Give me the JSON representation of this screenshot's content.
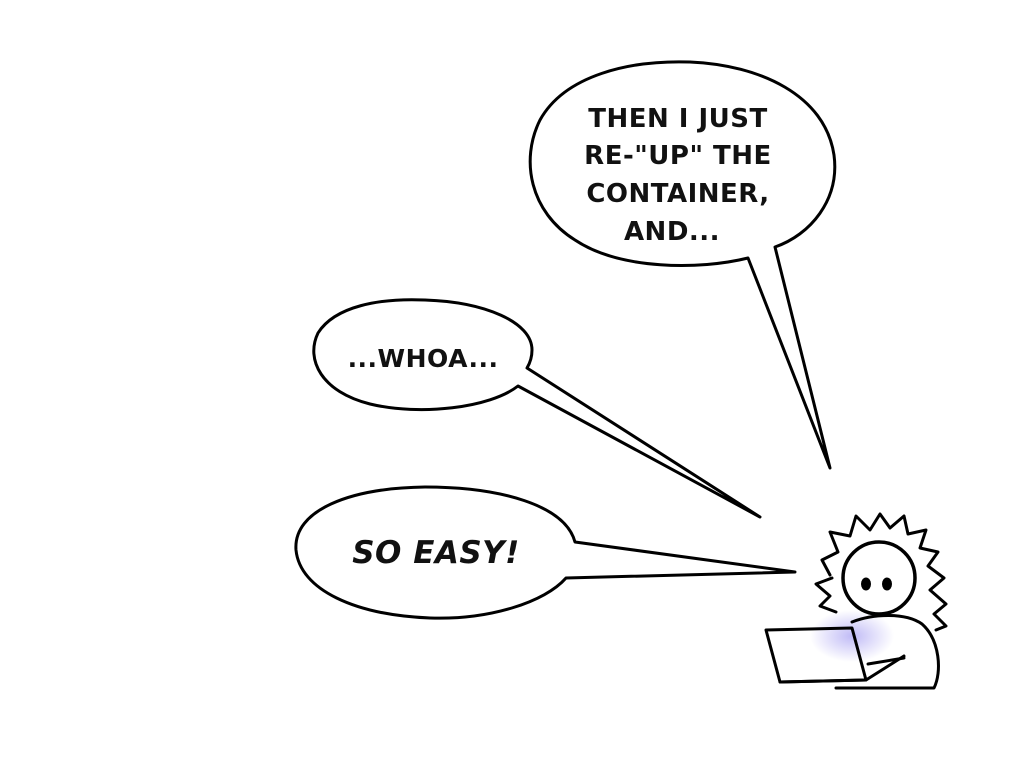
{
  "comic": {
    "bubbles": {
      "top": {
        "lines": [
          "THEN I JUST",
          "RE-\"UP\" THE",
          "CONTAINER,",
          "AND..."
        ]
      },
      "middle": {
        "text": "...WHOA..."
      },
      "bottom": {
        "text": "SO EASY!"
      }
    },
    "character": {
      "icon": "stick-figure-with-laptop-icon",
      "screen_glow_color": "#b9b3f5"
    },
    "colors": {
      "ink": "#000000",
      "background": "#ffffff"
    }
  }
}
